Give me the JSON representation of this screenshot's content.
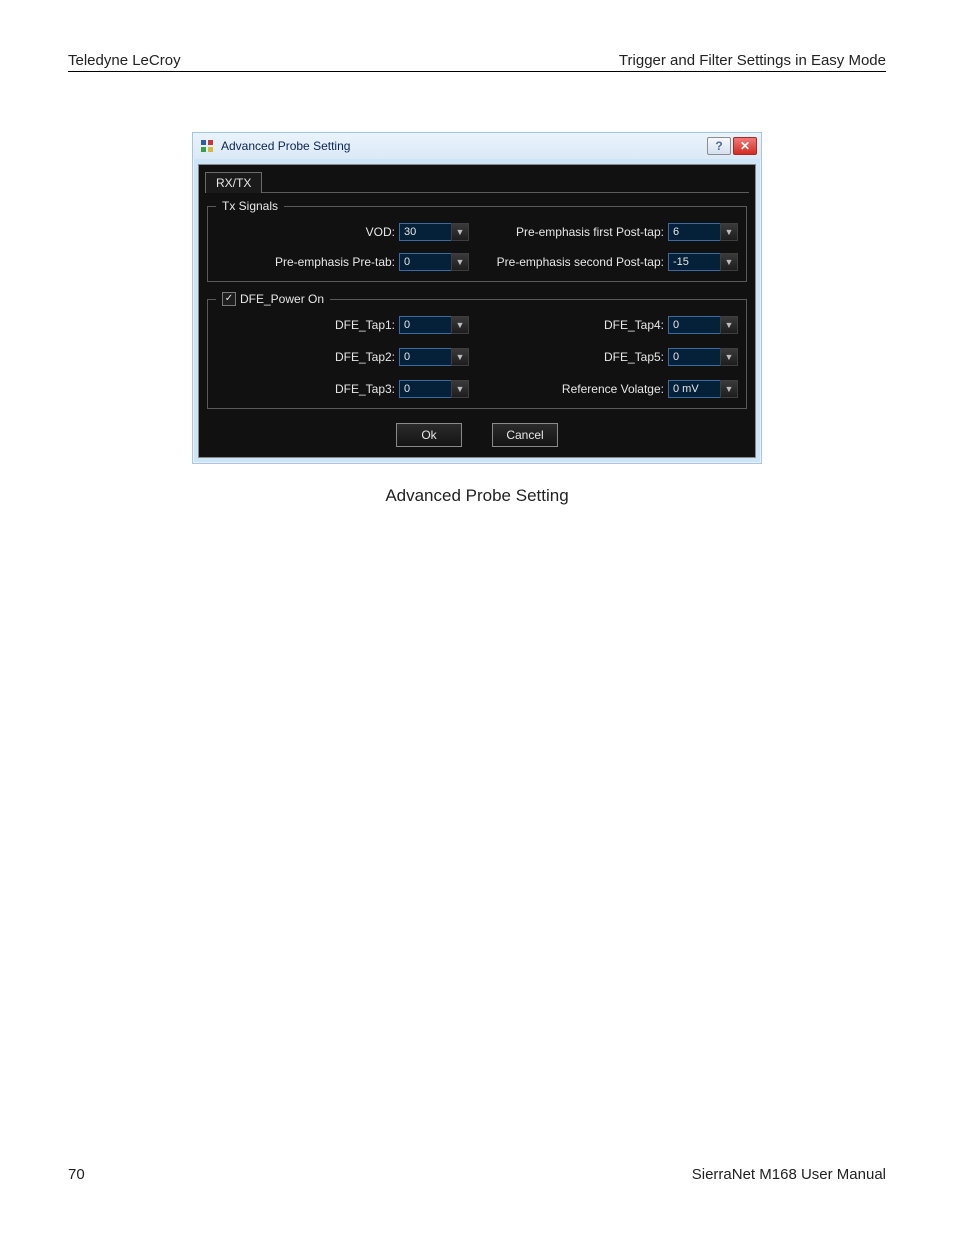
{
  "doc_header": {
    "left": "Teledyne LeCroy",
    "right": "Trigger and Filter Settings in Easy Mode"
  },
  "dialog": {
    "title": "Advanced Probe Setting",
    "help_char": "?",
    "close_char": "✕",
    "tab_label": "RX/TX",
    "tx_signals": {
      "legend": "Tx Signals",
      "vod_label": "VOD:",
      "vod_value": "30",
      "preemph_pretab_label": "Pre-emphasis Pre-tab:",
      "preemph_pretab_value": "0",
      "preemph_first_label": "Pre-emphasis first Post-tap:",
      "preemph_first_value": "6",
      "preemph_second_label": "Pre-emphasis second Post-tap:",
      "preemph_second_value": "-15"
    },
    "dfe": {
      "legend": "DFE_Power On",
      "checked": "✓",
      "tap1_label": "DFE_Tap1:",
      "tap1_value": "0",
      "tap2_label": "DFE_Tap2:",
      "tap2_value": "0",
      "tap3_label": "DFE_Tap3:",
      "tap3_value": "0",
      "tap4_label": "DFE_Tap4:",
      "tap4_value": "0",
      "tap5_label": "DFE_Tap5:",
      "tap5_value": "0",
      "refvolt_label": "Reference Volatge:",
      "refvolt_value": "0 mV"
    },
    "ok_label": "Ok",
    "cancel_label": "Cancel"
  },
  "caption": "Advanced Probe Setting",
  "doc_footer": {
    "page": "70",
    "right": "SierraNet M168 User Manual"
  }
}
